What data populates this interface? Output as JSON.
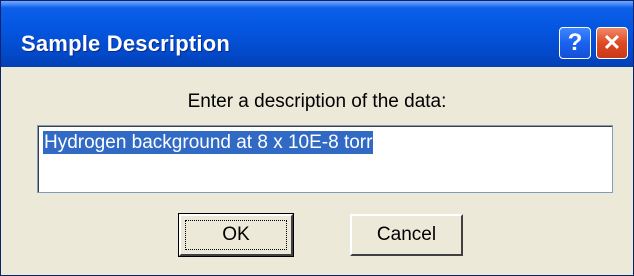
{
  "window": {
    "title": "Sample Description",
    "help_label": "?",
    "close_label": "✕"
  },
  "prompt": {
    "text": "Enter a description of the data:"
  },
  "description": {
    "value": "Hydrogen background at 8 x 10E-8 torr"
  },
  "buttons": {
    "ok_label": "OK",
    "cancel_label": "Cancel"
  },
  "colors": {
    "titlebar": "#0455df",
    "close": "#df4a22",
    "selection": "#316ac5",
    "face": "#ece9d8"
  }
}
